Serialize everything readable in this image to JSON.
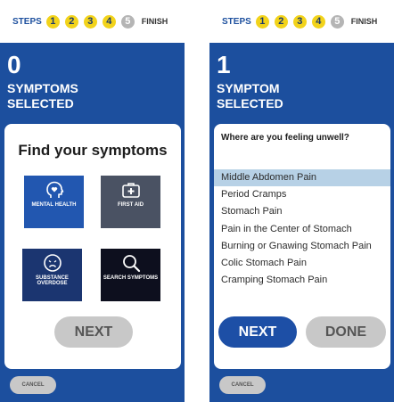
{
  "colors": {
    "brand_blue": "#1c4f9e",
    "step_yellow": "#f2d31b",
    "step_inactive": "#b5b5b5",
    "selected_row": "#b7d1e6",
    "button_gray": "#c8c8c8"
  },
  "left": {
    "steps": {
      "label": "STEPS",
      "items": [
        "1",
        "2",
        "3",
        "4",
        "5"
      ],
      "finish": "FINISH"
    },
    "count": "0",
    "count_label": "SYMPTOMS SELECTED",
    "card_title": "Find your symptoms",
    "tiles": [
      {
        "label": "MENTAL HEALTH",
        "icon": "head-heart-icon"
      },
      {
        "label": "FIRST AID",
        "icon": "first-aid-kit-icon"
      },
      {
        "label": "SUBSTANCE OVERDOSE",
        "icon": "sick-face-icon"
      },
      {
        "label": "SEARCH SYMPTOMS",
        "icon": "search-icon"
      }
    ],
    "next": "NEXT",
    "cancel": "CANCEL"
  },
  "right": {
    "steps": {
      "label": "STEPS",
      "items": [
        "1",
        "2",
        "3",
        "4",
        "5"
      ],
      "finish": "FINISH"
    },
    "count": "1",
    "count_label": "SYMPTOM SELECTED",
    "question": "Where are you feeling unwell?",
    "symptoms": [
      "Middle Abdomen Pain",
      "Period Cramps",
      "Stomach Pain",
      "Pain in the Center of Stomach",
      "Burning or Gnawing Stomach Pain",
      "Colic Stomach Pain",
      "Cramping Stomach Pain"
    ],
    "selected_symptom": "Middle Abdomen Pain",
    "next": "NEXT",
    "done": "DONE",
    "cancel": "CANCEL"
  }
}
